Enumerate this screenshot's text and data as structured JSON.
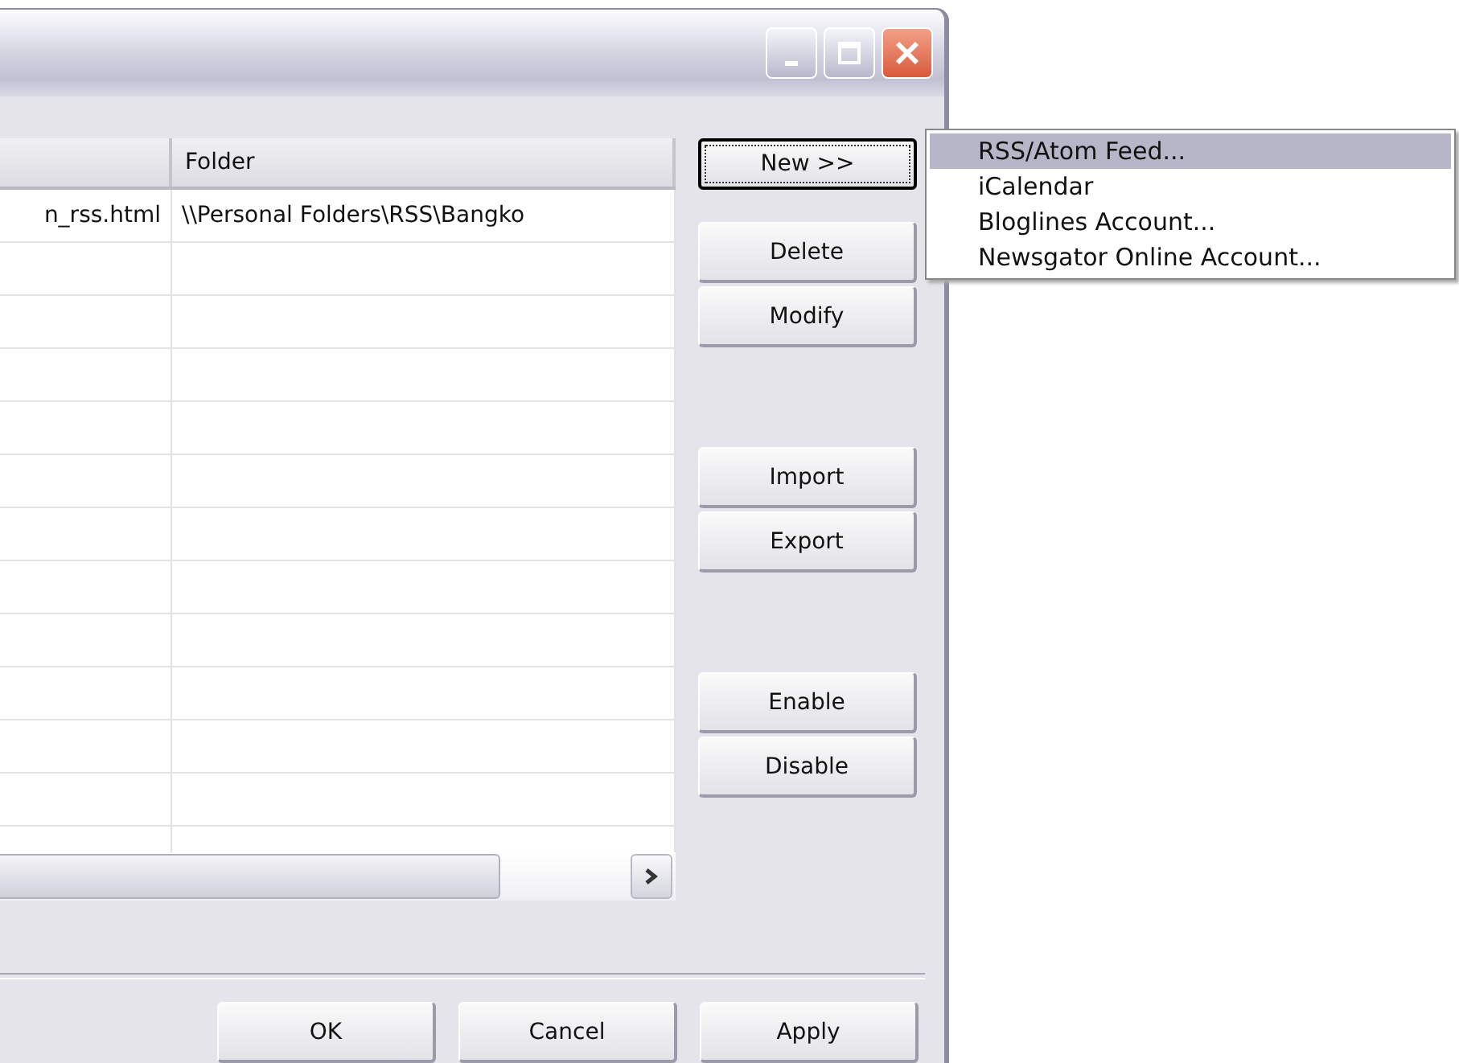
{
  "table": {
    "columns": [
      {},
      {
        "label": "Folder"
      }
    ],
    "rows": [
      {
        "cells": [
          "n_rss.html",
          "\\\\Personal Folders\\RSS\\Bangko"
        ]
      }
    ]
  },
  "side_button_groups": [
    [
      {
        "label": "New >>",
        "focused": true
      },
      {
        "label": "Delete",
        "focused": false
      },
      {
        "label": "Modify",
        "focused": false
      }
    ],
    [
      {
        "label": "Import",
        "focused": false
      },
      {
        "label": "Export",
        "focused": false
      }
    ],
    [
      {
        "label": "Enable",
        "focused": false
      },
      {
        "label": "Disable",
        "focused": false
      }
    ]
  ],
  "menu": {
    "items": [
      {
        "label": "RSS/Atom Feed...",
        "selected": true
      },
      {
        "label": "iCalendar",
        "selected": false
      },
      {
        "label": "Bloglines Account...",
        "selected": false
      },
      {
        "label": "Newsgator Online Account...",
        "selected": false
      }
    ]
  },
  "dialog_buttons": [
    "OK",
    "Cancel",
    "Apply"
  ]
}
